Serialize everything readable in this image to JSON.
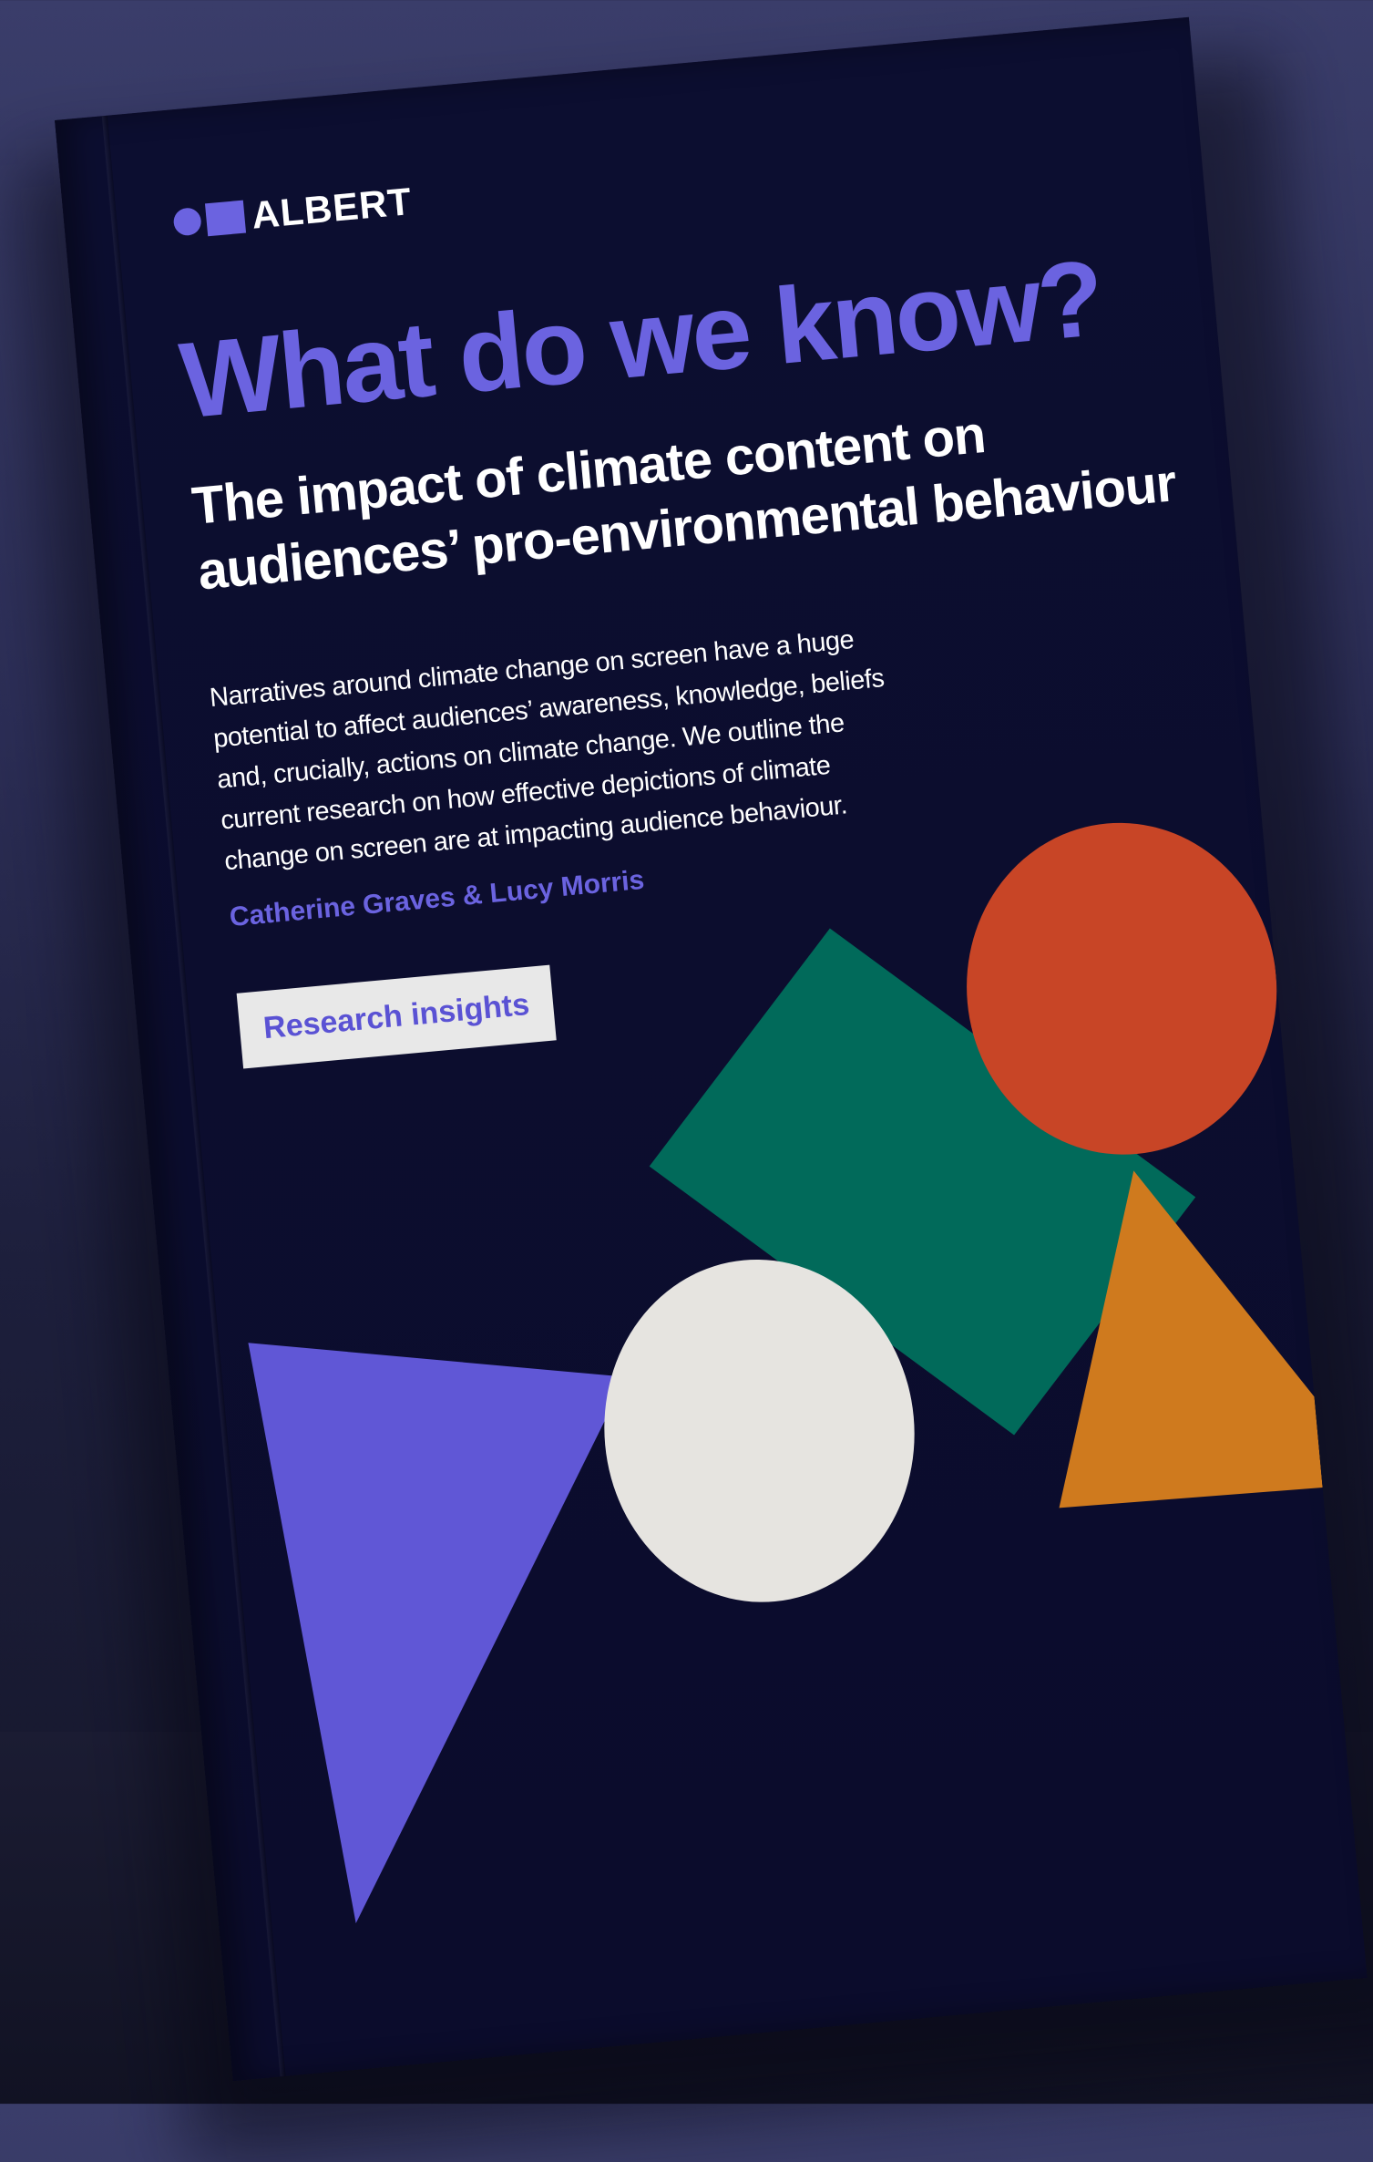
{
  "cover": {
    "brand": "ALBERT",
    "title": "What do we know?",
    "subtitle": "The impact of climate content on audiences’ pro-environmental behaviour",
    "description": "Narratives around climate change on screen have a huge potential to affect audiences’ awareness, knowledge, beliefs and, crucially, actions on climate change. We outline the current research on how effective depictions of climate change on screen are at impacting audience behaviour.",
    "authors": "Catherine Graves & Lucy Morris",
    "badge": "Research insights"
  },
  "colors": {
    "background": "#2b2d55",
    "cover": "#0c0e30",
    "accent_purple": "#6b63e0",
    "shape_green": "#016a5a",
    "shape_red": "#c84526",
    "shape_orange": "#cf7a1e",
    "shape_white": "#e6e4e0",
    "shape_purple": "#6057d6"
  },
  "icons": {
    "logo": "albert-dot-square-logo"
  }
}
